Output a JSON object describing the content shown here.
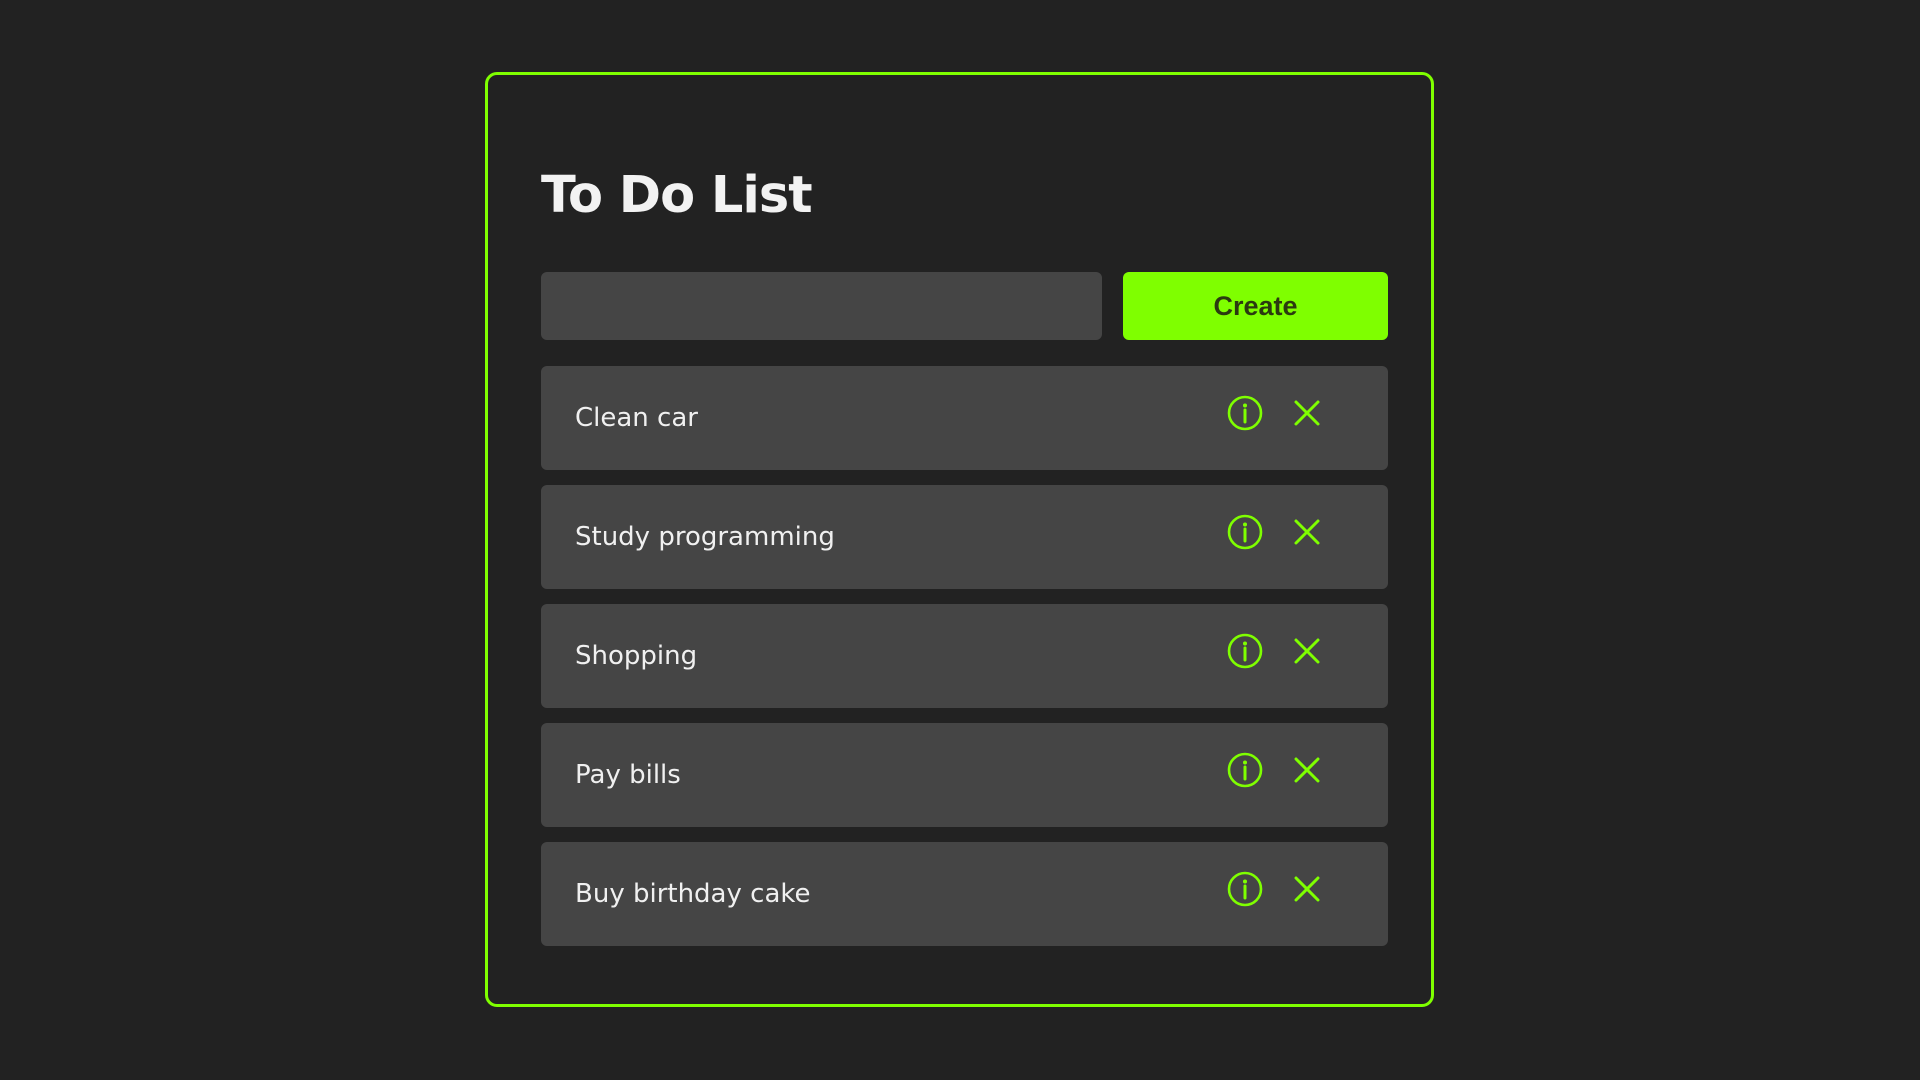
{
  "app": {
    "title": "To Do List"
  },
  "new_task": {
    "value": "",
    "placeholder": "",
    "create_label": "Create"
  },
  "todos": [
    {
      "label": "Clean car"
    },
    {
      "label": "Study programming"
    },
    {
      "label": "Shopping"
    },
    {
      "label": "Pay bills"
    },
    {
      "label": "Buy birthday cake"
    }
  ],
  "icons": {
    "info": "info-circle-icon",
    "delete": "close-x-icon"
  },
  "colors": {
    "accent": "#7fff00",
    "background": "#222222",
    "surface": "#454545",
    "text": "#f0f0f0"
  }
}
